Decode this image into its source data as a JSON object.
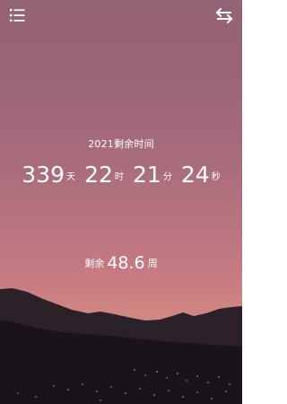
{
  "header": {
    "menu_icon": "list-menu-icon",
    "swap_icon": "swap-arrows-icon"
  },
  "countdown": {
    "title": "2021剩余时间",
    "days": "339",
    "days_unit": "天",
    "hours": "22",
    "hours_unit": "时",
    "minutes": "21",
    "minutes_unit": "分",
    "seconds": "24",
    "seconds_unit": "秒"
  },
  "weeks": {
    "label": "剩余",
    "value": "48.6",
    "unit": "周"
  },
  "colors": {
    "sky_top": "#946375",
    "sky_glow": "#d18783",
    "mountain": "#1f1820",
    "text": "#ffffff"
  }
}
